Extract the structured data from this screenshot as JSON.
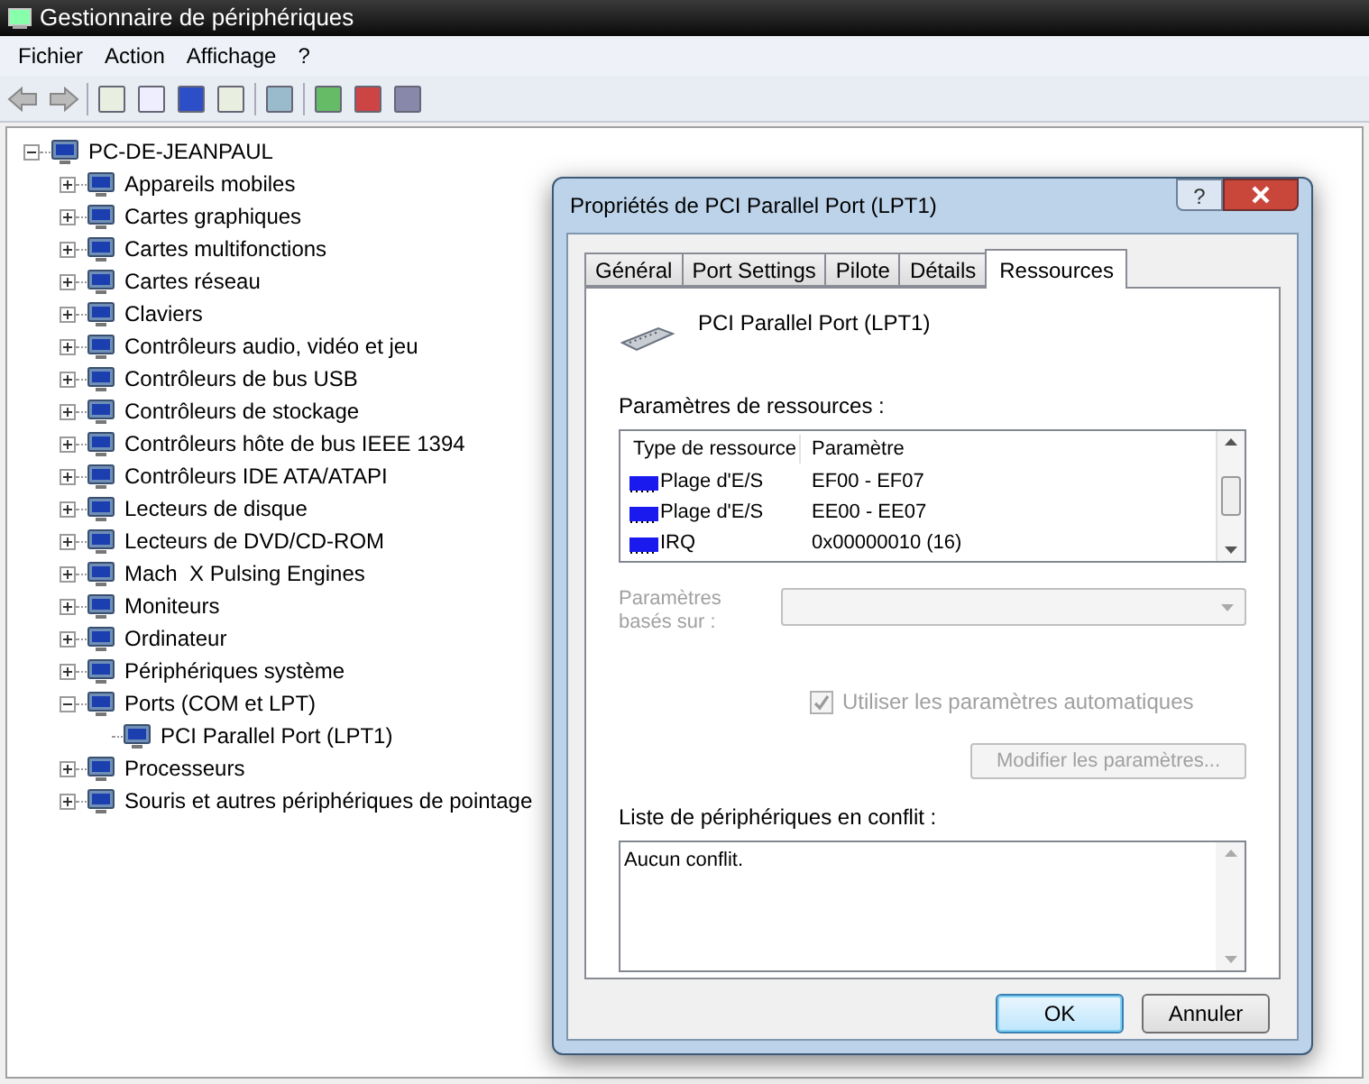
{
  "window": {
    "title": "Gestionnaire de périphériques"
  },
  "menu": [
    {
      "label": "Fichier"
    },
    {
      "label": "Action"
    },
    {
      "label": "Affichage"
    },
    {
      "label": "?"
    }
  ],
  "tree": {
    "label": "PC-DE-JEANPAUL",
    "expanded": true,
    "children": [
      {
        "label": "Appareils mobiles",
        "expanded": false
      },
      {
        "label": "Cartes graphiques",
        "expanded": false
      },
      {
        "label": "Cartes multifonctions",
        "expanded": false
      },
      {
        "label": "Cartes réseau",
        "expanded": false
      },
      {
        "label": "Claviers",
        "expanded": false
      },
      {
        "label": "Contrôleurs audio, vidéo et jeu",
        "expanded": false
      },
      {
        "label": "Contrôleurs de bus USB",
        "expanded": false
      },
      {
        "label": "Contrôleurs de stockage",
        "expanded": false
      },
      {
        "label": "Contrôleurs hôte de bus IEEE 1394",
        "expanded": false
      },
      {
        "label": "Contrôleurs IDE ATA/ATAPI",
        "expanded": false
      },
      {
        "label": "Lecteurs de disque",
        "expanded": false
      },
      {
        "label": "Lecteurs de DVD/CD-ROM",
        "expanded": false
      },
      {
        "label": "Mach  X Pulsing Engines",
        "expanded": false
      },
      {
        "label": "Moniteurs",
        "expanded": false
      },
      {
        "label": "Ordinateur",
        "expanded": false
      },
      {
        "label": "Périphériques système",
        "expanded": false
      },
      {
        "label": "Ports (COM et LPT)",
        "expanded": true,
        "children": [
          {
            "label": "PCI Parallel Port (LPT1)"
          }
        ]
      },
      {
        "label": "Processeurs",
        "expanded": false
      },
      {
        "label": "Souris et autres périphériques de pointage",
        "expanded": false
      }
    ]
  },
  "dialog": {
    "title": "Propriétés de PCI Parallel Port (LPT1)",
    "help_button": "?",
    "tabs": [
      {
        "label": "Général",
        "selected": false
      },
      {
        "label": "Port Settings",
        "selected": false
      },
      {
        "label": "Pilote",
        "selected": false
      },
      {
        "label": "Détails",
        "selected": false
      },
      {
        "label": "Ressources",
        "selected": true
      }
    ],
    "device_name": "PCI Parallel Port (LPT1)",
    "resources_label": "Paramètres de ressources :",
    "resources_table": {
      "columns": [
        "Type de ressource",
        "Paramètre"
      ],
      "rows": [
        {
          "type": "Plage d'E/S",
          "value": "EF00 - EF07"
        },
        {
          "type": "Plage d'E/S",
          "value": "EE00 - EE07"
        },
        {
          "type": "IRQ",
          "value": "0x00000010 (16)"
        }
      ]
    },
    "settings_based_on": {
      "label_lines": [
        "Paramètres",
        "basés sur :"
      ],
      "disabled": true
    },
    "auto_settings": {
      "label": "Utiliser les paramètres automatiques",
      "checked": true,
      "disabled": true
    },
    "modify_button": {
      "label": "Modifier les paramètres...",
      "disabled": true
    },
    "conflicts_label": "Liste de périphériques en conflit :",
    "conflicts_text": "Aucun conflit.",
    "buttons": [
      {
        "label": "OK",
        "default": true
      },
      {
        "label": "Annuler",
        "default": false
      }
    ]
  }
}
